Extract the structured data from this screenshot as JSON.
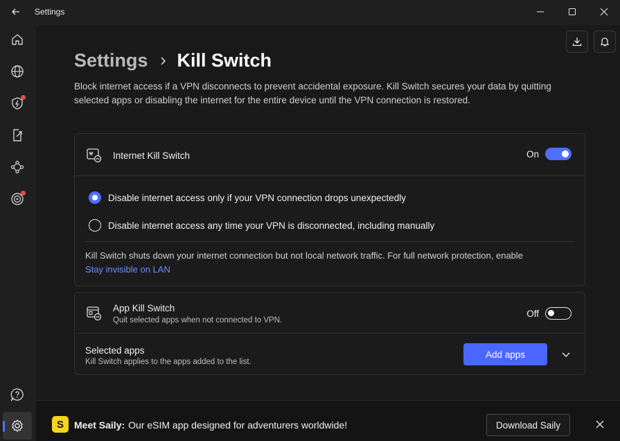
{
  "window": {
    "title": "Settings"
  },
  "breadcrumb": {
    "parent": "Settings",
    "current": "Kill Switch"
  },
  "description": "Block internet access if a VPN disconnects to prevent accidental exposure. Kill Switch secures your data by quitting selected apps or disabling the internet for the entire device until the VPN connection is restored.",
  "internet_kill_switch": {
    "title": "Internet Kill Switch",
    "state_label": "On",
    "enabled": true,
    "options": [
      {
        "label": "Disable internet access only if your VPN connection drops unexpectedly",
        "selected": true
      },
      {
        "label": "Disable internet access any time your VPN is disconnected, including manually",
        "selected": false
      }
    ],
    "note": "Kill Switch shuts down your internet connection but not local network traffic. For full network protection, enable",
    "note_link": "Stay invisible on LAN"
  },
  "app_kill_switch": {
    "title": "App Kill Switch",
    "subtitle": "Quit selected apps when not connected to VPN.",
    "state_label": "Off",
    "enabled": false,
    "selected_apps_title": "Selected apps",
    "selected_apps_subtitle": "Kill Switch applies to the apps added to the list.",
    "add_button": "Add apps"
  },
  "promo": {
    "logo_letter": "S",
    "title": "Meet Saily:",
    "text": "Our eSIM app designed for adventurers worldwide!",
    "button": "Download Saily"
  },
  "colors": {
    "accent": "#4a66ff",
    "alert": "#e5484d",
    "promo_logo": "#f6d51b"
  },
  "icons": {
    "sidebar": [
      "home-icon",
      "globe-icon",
      "shield-bolt-icon",
      "share-file-icon",
      "meshnet-icon",
      "target-icon",
      "help-icon",
      "settings-icon"
    ]
  }
}
